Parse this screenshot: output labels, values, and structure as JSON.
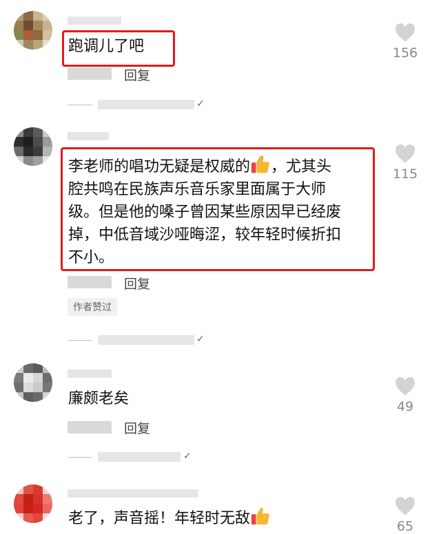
{
  "icons": {
    "like": "heart-icon",
    "emoji": "thumbs-up-icon",
    "verified": "check-icon"
  },
  "colors": {
    "highlight_box": "#e11a1a",
    "like_icon": "#d3d3d3",
    "count_text": "#888888"
  },
  "comments": [
    {
      "text": "跑调儿了吧",
      "likes": "156",
      "reply": "回复"
    },
    {
      "text_lines": [
        "李老师的唱功无疑是权威的",
        "，尤其头",
        "腔共鸣在民族声乐音乐家里面属于大师",
        "级。但是他的嗓子曾因某些原因早已经废",
        "掉，中低音域沙哑晦涩，较年轻时候折扣",
        "不小。"
      ],
      "likes": "115",
      "reply": "回复",
      "author_tag": "作者赞过"
    },
    {
      "text": "廉颇老矣",
      "likes": "49",
      "reply": "回复"
    },
    {
      "text": "老了，声音摇！年轻时无敌",
      "likes": "65"
    }
  ]
}
